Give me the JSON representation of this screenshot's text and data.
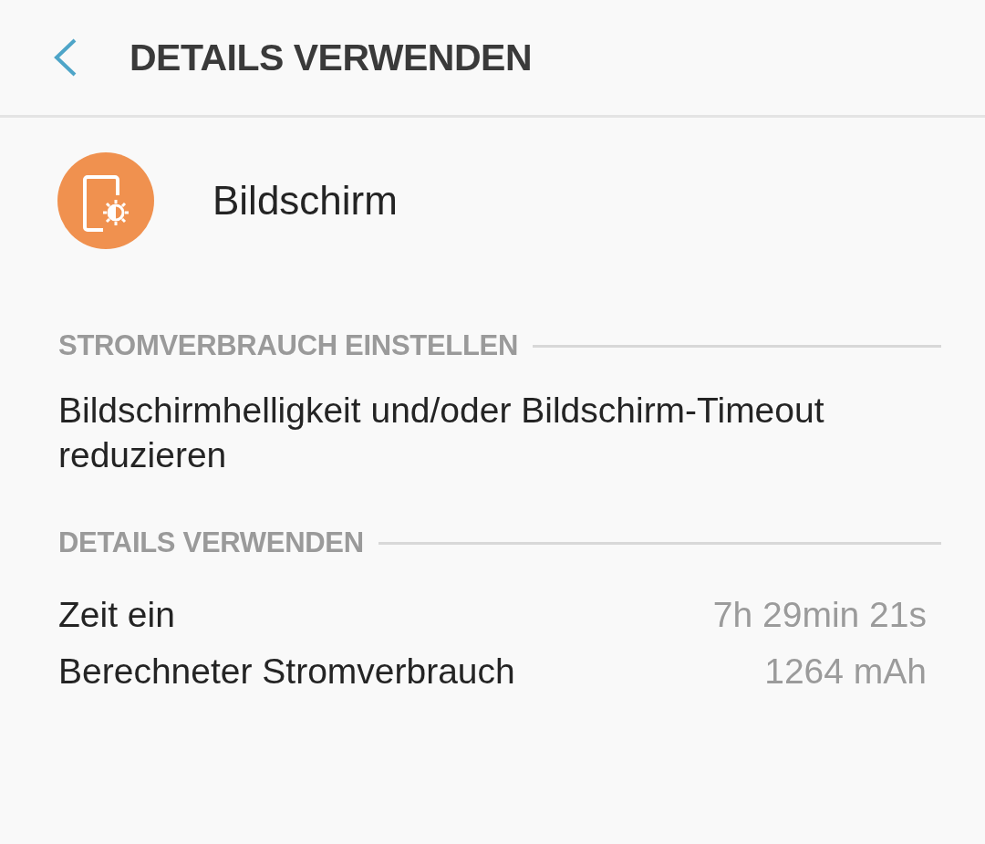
{
  "header": {
    "title": "DETAILS VERWENDEN"
  },
  "app": {
    "name": "Bildschirm"
  },
  "sections": [
    {
      "kind": "text",
      "title": "STROMVERBRAUCH EINSTELLEN",
      "text": "Bildschirmhelligkeit und/oder Bildschirm-Timeout reduzieren"
    },
    {
      "kind": "details",
      "title": "DETAILS VERWENDEN",
      "rows": [
        {
          "label": "Zeit ein",
          "value": "7h 29min 21s"
        },
        {
          "label": "Berechneter Stromverbrauch",
          "value": "1264 mAh"
        }
      ]
    }
  ]
}
